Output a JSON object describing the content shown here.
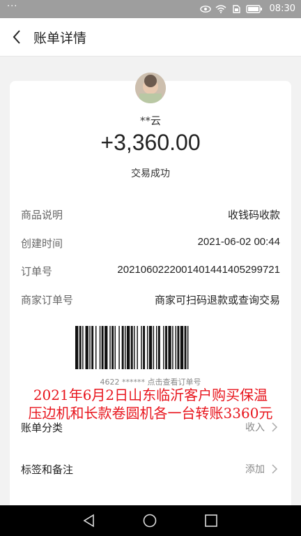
{
  "status_bar": {
    "left_indicator": "···",
    "time": "08:30"
  },
  "header": {
    "title": "账单详情"
  },
  "transaction": {
    "payer": "**云",
    "amount": "+3,360.00",
    "status": "交易成功"
  },
  "details": [
    {
      "label": "商品说明",
      "value": "收钱码收款"
    },
    {
      "label": "创建时间",
      "value": "2021-06-02 00:44"
    },
    {
      "label": "订单号",
      "value": "2021060222001401441405299721"
    },
    {
      "label": "商家订单号",
      "value": "商家可扫码退款或查询交易"
    }
  ],
  "barcode": {
    "caption": "4622 ****** 点击查看订单号"
  },
  "overlay_text": {
    "line1": "2021年6月2日山东临沂客户购买保温",
    "line2": "压边机和长款卷圆机各一台转账3360元"
  },
  "options": [
    {
      "label": "账单分类",
      "value": "收入"
    },
    {
      "label": "标签和备注",
      "value": "添加"
    }
  ],
  "colors": {
    "overlay_red": "#e8141c",
    "background": "#f2f2f2"
  },
  "icons": [
    "back-arrow-icon",
    "eye-icon",
    "wifi-icon",
    "sim-icon",
    "battery-icon",
    "nav-back-icon",
    "nav-home-icon",
    "nav-recent-icon",
    "chevron-right-icon"
  ]
}
